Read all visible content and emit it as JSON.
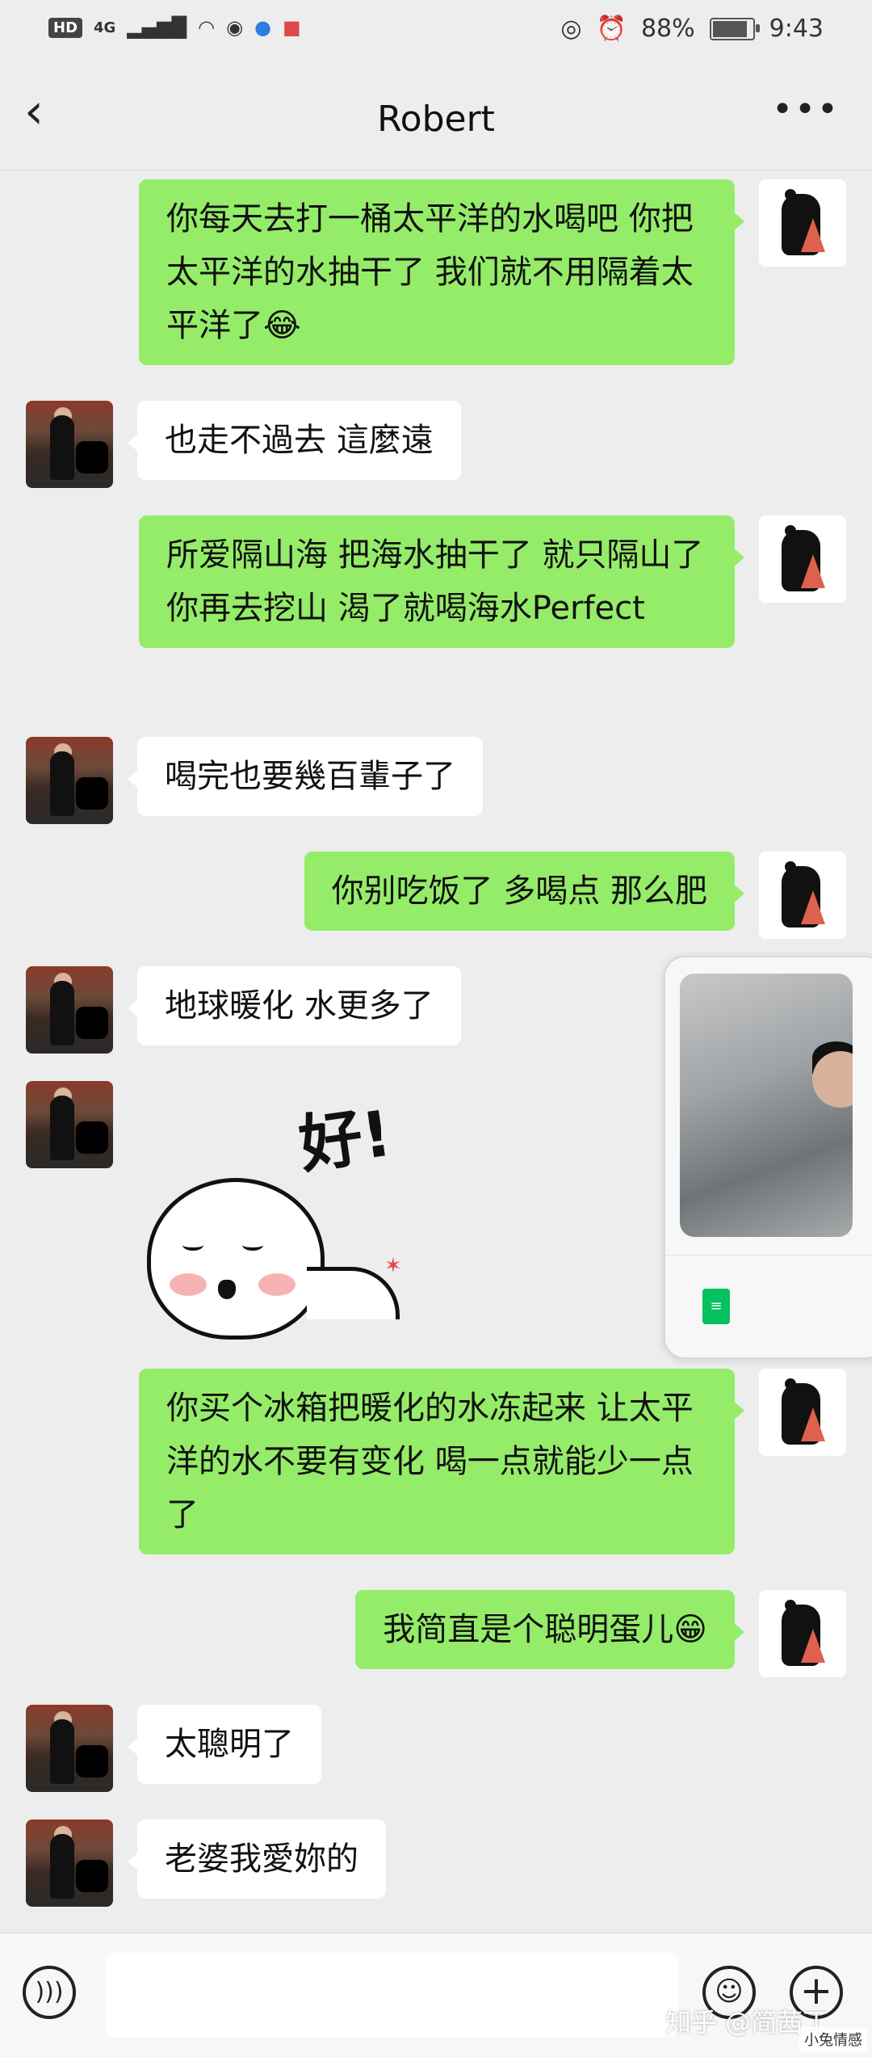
{
  "status_bar": {
    "hd": "HD",
    "network": "4G",
    "battery": "88%",
    "battery_level": 0.88,
    "time": "9:43"
  },
  "header": {
    "title": "Robert"
  },
  "messages": [
    {
      "side": "out",
      "text": "你每天去打一桶太平洋的水喝吧 你把太平洋的水抽干了 我们就不用隔着太平洋了😂"
    },
    {
      "side": "in",
      "text": "也走不過去 這麼遠"
    },
    {
      "side": "out",
      "text": "所爱隔山海 把海水抽干了 就只隔山了 你再去挖山 渴了就喝海水Perfect"
    },
    {
      "side": "in",
      "text": "喝完也要幾百輩子了"
    },
    {
      "side": "out",
      "text": "你别吃饭了 多喝点 那么肥"
    },
    {
      "side": "in",
      "text": "地球暖化 水更多了"
    },
    {
      "side": "in",
      "type": "sticker",
      "text": "好!"
    },
    {
      "side": "out",
      "text": "你买个冰箱把暖化的水冻起来 让太平洋的水不要有变化 喝一点就能少一点了"
    },
    {
      "side": "out",
      "text": "我简直是个聪明蛋儿😁"
    },
    {
      "side": "in",
      "text": "太聰明了"
    },
    {
      "side": "in",
      "text": "老婆我愛妳的"
    }
  ],
  "input_bar": {
    "value": ""
  },
  "watermark": {
    "text": "知乎 @简茜丁",
    "site": "小兔情感"
  },
  "colors": {
    "outgoing_bubble": "#95ec69",
    "incoming_bubble": "#ffffff",
    "background": "#ededed"
  }
}
